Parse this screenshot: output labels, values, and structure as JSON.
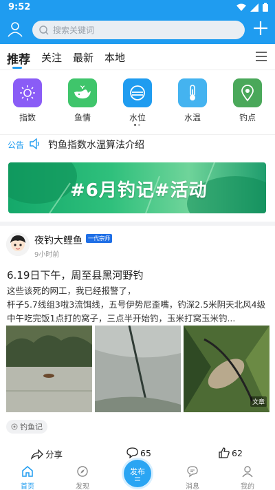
{
  "status": {
    "time": "9:52"
  },
  "search": {
    "placeholder": "搜索关键词"
  },
  "tabs": [
    {
      "label": "推荐",
      "active": true
    },
    {
      "label": "关注"
    },
    {
      "label": "最新"
    },
    {
      "label": "本地"
    }
  ],
  "categories": [
    {
      "label": "指数",
      "icon": "sun-icon",
      "color": "#8a5cf6"
    },
    {
      "label": "鱼情",
      "icon": "whale-icon",
      "color": "#3fc56b"
    },
    {
      "label": "水位",
      "icon": "water-level-icon",
      "color": "#1f9cf0"
    },
    {
      "label": "水温",
      "icon": "thermometer-icon",
      "color": "#44b3f0"
    },
    {
      "label": "钓点",
      "icon": "location-pin-icon",
      "color": "#4aa85a"
    }
  ],
  "notice": {
    "tag": "公告",
    "text": "钓鱼指数水温算法介绍"
  },
  "banner": {
    "text": "#6月钓记#活动"
  },
  "post": {
    "author": "夜钓大鲤鱼",
    "badge": "一代宗师",
    "time": "9小时前",
    "title": "6.19日下午，周至县黑河野钓",
    "body": [
      "这些该死的网工，我已经报警了，",
      "杆子5.7线组3啦3流饵线，五号伊势尼歪嘴，钓深2.5米阴天北风4级",
      "中午吃完饭1点打的窝子，三点半开始钓，玉米打窝玉米钓..."
    ],
    "doc_label": "文章",
    "tag": "钓鱼记",
    "share_label": "分享",
    "comments": "65",
    "likes": "62"
  },
  "bottom_nav": [
    {
      "label": "首页",
      "active": true
    },
    {
      "label": "发现"
    },
    {
      "label": "发布"
    },
    {
      "label": "消息"
    },
    {
      "label": "我的"
    }
  ],
  "colors": {
    "primary": "#1f9cf0"
  }
}
